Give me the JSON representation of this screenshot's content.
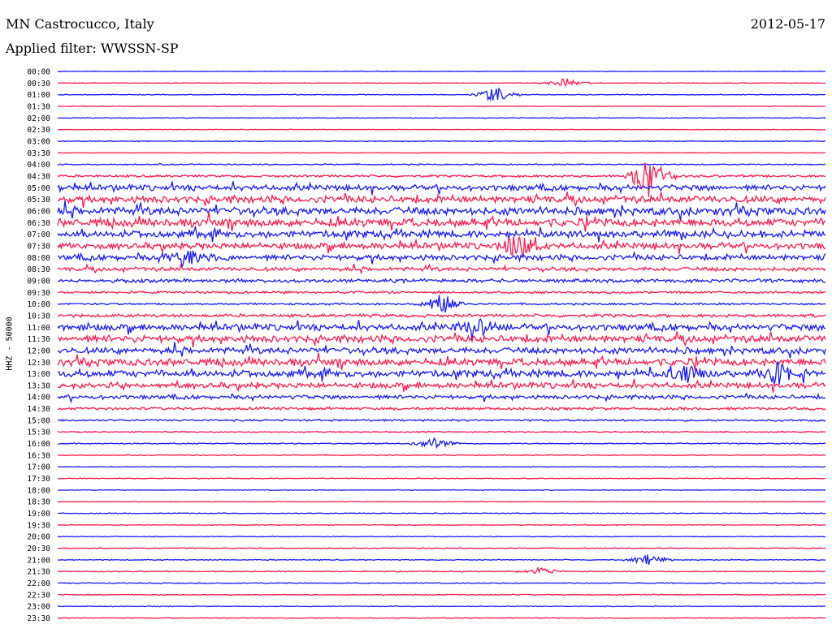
{
  "header": {
    "station": "MN Castrocucco, Italy",
    "date": "2012-05-17",
    "filter": "Applied filter: WWSSN-SP"
  },
  "chart_data": {
    "type": "line",
    "title": "MN Castrocucco, Italy",
    "subtitle": "Applied filter: WWSSN-SP",
    "date": "2012-05-17",
    "ylabel": "HHZ - 50000",
    "series_colors": [
      "#1a1aff",
      "#ff1a4d"
    ],
    "tick_labels": [
      "00:00",
      "00:30",
      "01:00",
      "01:30",
      "02:00",
      "02:30",
      "03:00",
      "03:30",
      "04:00",
      "04:30",
      "05:00",
      "05:30",
      "06:00",
      "06:30",
      "07:00",
      "07:30",
      "08:00",
      "08:30",
      "09:00",
      "09:30",
      "10:00",
      "10:30",
      "11:00",
      "11:30",
      "12:00",
      "12:30",
      "13:00",
      "13:30",
      "14:00",
      "14:30",
      "15:00",
      "15:30",
      "16:00",
      "16:30",
      "17:00",
      "17:30",
      "18:00",
      "18:30",
      "19:00",
      "19:30",
      "20:00",
      "20:30",
      "21:00",
      "21:30",
      "22:00",
      "22:30",
      "23:00",
      "23:30"
    ],
    "trace_activity": [
      0.15,
      0.15,
      0.2,
      0.15,
      0.2,
      0.15,
      0.2,
      0.15,
      0.3,
      0.6,
      1.4,
      1.8,
      2.0,
      2.0,
      1.8,
      1.6,
      1.4,
      1.0,
      0.9,
      0.6,
      0.5,
      0.8,
      1.6,
      1.8,
      1.6,
      1.8,
      1.8,
      1.4,
      1.0,
      0.7,
      0.5,
      0.3,
      0.3,
      0.25,
      0.2,
      0.2,
      0.2,
      0.2,
      0.2,
      0.2,
      0.2,
      0.2,
      0.25,
      0.25,
      0.25,
      0.25,
      0.2,
      0.2
    ],
    "events": [
      {
        "row": 1,
        "t": 0.66,
        "amp": 8
      },
      {
        "row": 2,
        "t": 0.57,
        "amp": 14
      },
      {
        "row": 9,
        "t": 0.77,
        "amp": 40
      },
      {
        "row": 15,
        "t": 0.6,
        "amp": 24
      },
      {
        "row": 16,
        "t": 0.17,
        "amp": 18
      },
      {
        "row": 20,
        "t": 0.5,
        "amp": 18
      },
      {
        "row": 22,
        "t": 0.55,
        "amp": 14
      },
      {
        "row": 26,
        "t": 0.82,
        "amp": 14
      },
      {
        "row": 26,
        "t": 0.94,
        "amp": 16
      },
      {
        "row": 32,
        "t": 0.49,
        "amp": 10
      },
      {
        "row": 42,
        "t": 0.77,
        "amp": 9
      },
      {
        "row": 43,
        "t": 0.63,
        "amp": 6
      }
    ]
  }
}
